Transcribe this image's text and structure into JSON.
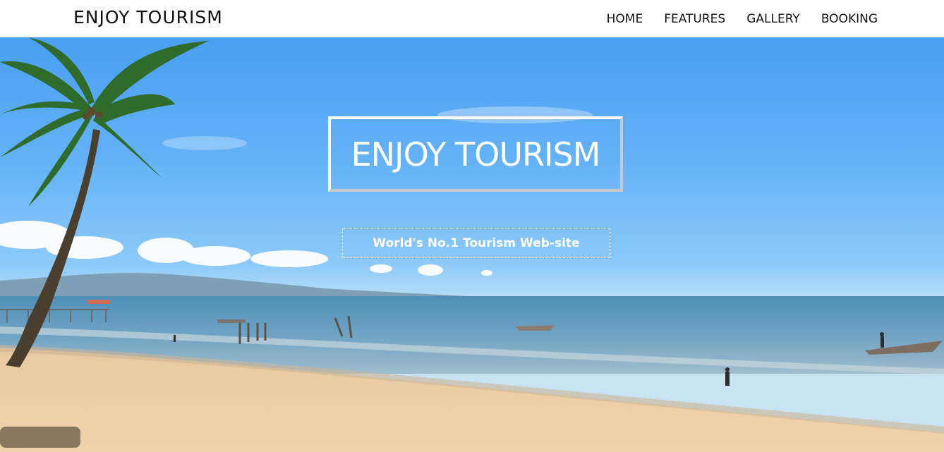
{
  "navbar": {
    "brand": "ENJOY TOURISM",
    "links": [
      "HOME",
      "FEATURES",
      "GALLERY",
      "BOOKING"
    ]
  },
  "hero": {
    "title": "ENJOY TOURISM",
    "subtitle": "World's No.1 Tourism Web-site",
    "image_description_colors": {
      "sky": "#5aaaf5",
      "sea": "#5e97bd",
      "sand": "#e9c9a0"
    }
  }
}
